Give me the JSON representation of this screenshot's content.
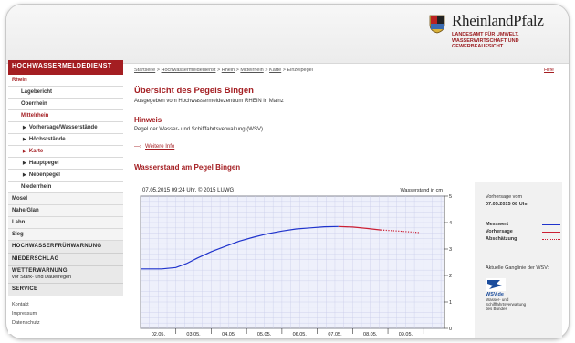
{
  "brand": {
    "name": "RheinlandPfalz",
    "subtitle_lines": [
      "LANDESAMT FÜR UMWELT,",
      "WASSERWIRTSCHAFT UND",
      "GEWERBEAUFSICHT"
    ]
  },
  "sidebar": {
    "header": "HOCHWASSERMELDEDIENST",
    "items": [
      {
        "label": "Rhein"
      },
      {
        "label": "Lagebericht"
      },
      {
        "label": "Oberrhein"
      },
      {
        "label": "Mittelrhein"
      },
      {
        "label": "Vorhersage/Wasserstände"
      },
      {
        "label": "Höchststände"
      },
      {
        "label": "Karte"
      },
      {
        "label": "Hauptpegel"
      },
      {
        "label": "Nebenpegel"
      },
      {
        "label": "Niederrhein"
      },
      {
        "label": "Mosel"
      },
      {
        "label": "Nahe/Glan"
      },
      {
        "label": "Lahn"
      },
      {
        "label": "Sieg"
      }
    ],
    "sections": {
      "fruehwarnung": "HOCHWASSERFRÜHWARNUNG",
      "niederschlag": "NIEDERSCHLAG",
      "wetterwarnung": "WETTERWARNUNG",
      "wetterwarnung_sub": "vor Stark- und Dauerregen",
      "service": "SERVICE"
    },
    "footer_links": [
      "Kontakt",
      "Impressum",
      "Datenschutz"
    ]
  },
  "breadcrumb": {
    "items": [
      "Startseite",
      "Hochwassermeldedienst",
      "Rhein",
      "Mittelrhein",
      "Karte"
    ],
    "current": "Einzelpegel",
    "separator": ">"
  },
  "help_link": "Hilfe",
  "page": {
    "title": "Übersicht des Pegels Bingen",
    "subtitle": "Ausgegeben vom Hochwassermeldezentrum RHEIN in Mainz",
    "hinweis_title": "Hinweis",
    "hinweis_text": "Pegel der Wasser- und Schifffahrtsverwaltung (WSV)",
    "more_arrow": "—›",
    "more_link": "Weitere Info",
    "section_title": "Wasserstand am Pegel Bingen"
  },
  "chart_data": {
    "type": "line",
    "title": "07.05.2015 09:24 Uhr, © 2015 LUWG",
    "ylabel": "Wasserstand in cm",
    "ylim": [
      0,
      500
    ],
    "yticks": [
      0,
      100,
      200,
      300,
      400,
      500
    ],
    "xlim": [
      0,
      8.6
    ],
    "xticks": [
      {
        "label": "02.05.",
        "x": 0.5
      },
      {
        "label": "03.05.",
        "x": 1.5
      },
      {
        "label": "04.05.",
        "x": 2.5
      },
      {
        "label": "05.05.",
        "x": 3.5
      },
      {
        "label": "06.05.",
        "x": 4.5
      },
      {
        "label": "07.05.",
        "x": 5.5
      },
      {
        "label": "08.05.",
        "x": 6.5
      },
      {
        "label": "09.05.",
        "x": 7.5
      }
    ],
    "grid": true,
    "series": [
      {
        "name": "Messwert",
        "color": "#1f33cc",
        "style": "solid",
        "points": [
          [
            0,
            225
          ],
          [
            0.6,
            225
          ],
          [
            1,
            230
          ],
          [
            1.3,
            245
          ],
          [
            1.6,
            265
          ],
          [
            2,
            290
          ],
          [
            2.4,
            310
          ],
          [
            2.8,
            330
          ],
          [
            3.2,
            345
          ],
          [
            3.6,
            358
          ],
          [
            4,
            368
          ],
          [
            4.4,
            376
          ],
          [
            4.8,
            380
          ],
          [
            5.2,
            384
          ],
          [
            5.6,
            385
          ]
        ]
      },
      {
        "name": "Vorhersage",
        "color": "#cc1f33",
        "style": "solid",
        "points": [
          [
            5.6,
            385
          ],
          [
            6,
            383
          ],
          [
            6.4,
            378
          ],
          [
            6.8,
            372
          ]
        ]
      },
      {
        "name": "Abschätzung",
        "color": "#cc1f33",
        "style": "dotted",
        "points": [
          [
            6.8,
            372
          ],
          [
            7.3,
            368
          ],
          [
            7.9,
            362
          ]
        ]
      }
    ]
  },
  "panel": {
    "forecast_label": "Vorhersage vom",
    "forecast_date": "07.05.2015 08 Uhr",
    "legend": [
      "Messwert",
      "Vorhersage",
      "Abschätzung"
    ],
    "wsv_text": "Aktuelle Ganglinie der WSV:",
    "wsv_logo": "WSV.de",
    "wsv_small": [
      "Wasser- und",
      "Schifffahrtsverwaltung",
      "des Bundes"
    ]
  },
  "colors": {
    "accent": "#a41e22",
    "measured": "#1f33cc",
    "forecast": "#cc1f33"
  }
}
